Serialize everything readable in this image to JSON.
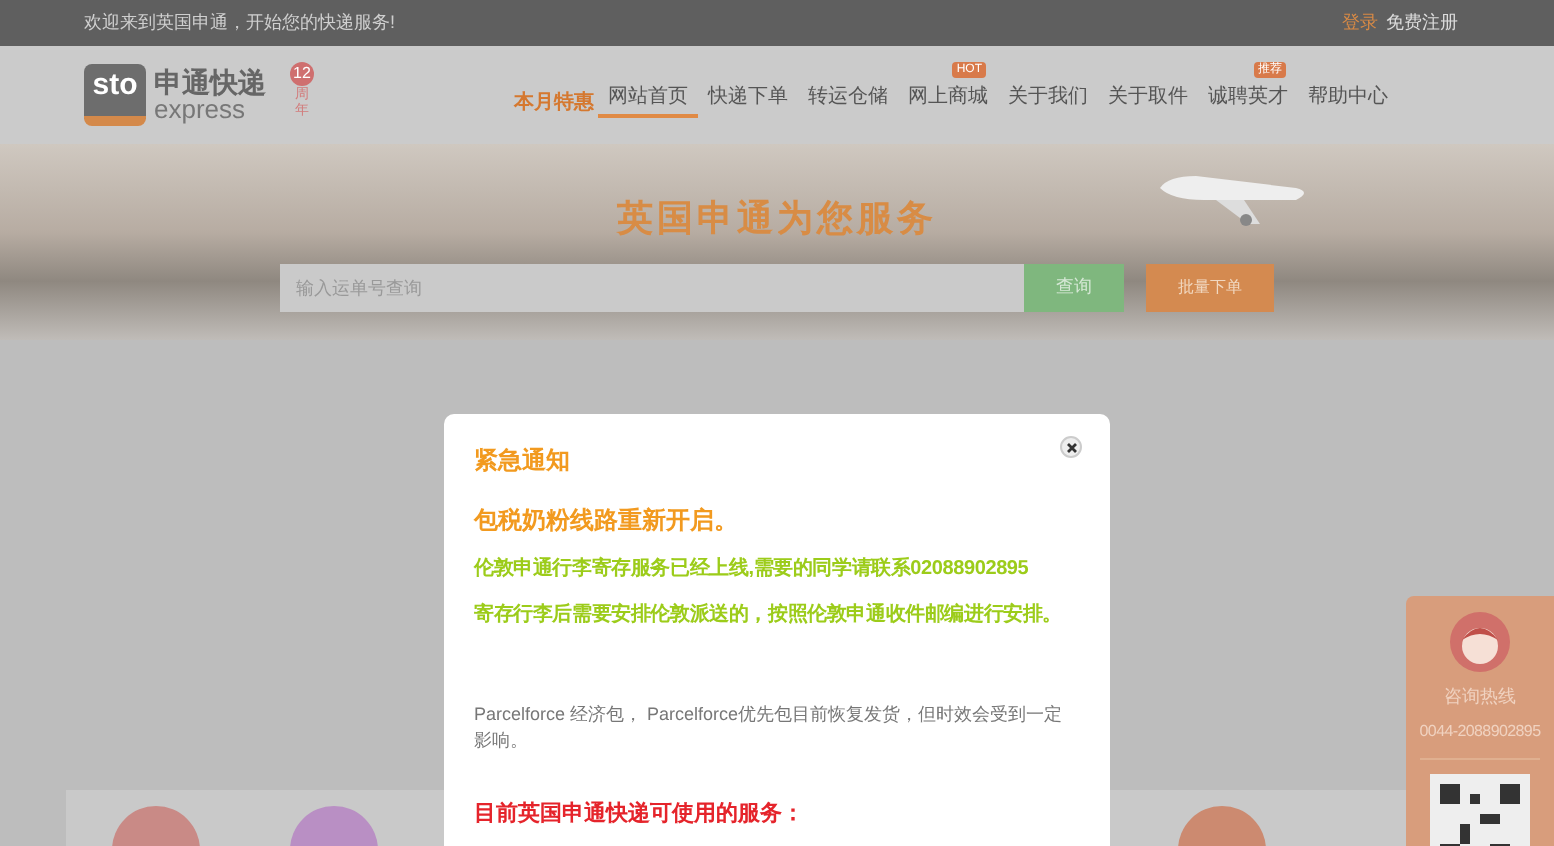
{
  "top_bar": {
    "welcome": "欢迎来到英国申通，开始您的快递服务!",
    "login": "登录",
    "register": "免费注册"
  },
  "header": {
    "logo": {
      "mark": "sto",
      "name": "申通快递",
      "name_en": "express"
    },
    "anniversary": {
      "number": "12",
      "chars": [
        "周",
        "年"
      ]
    },
    "promo": "本月特惠"
  },
  "nav": [
    {
      "label": "网站首页",
      "selected": true
    },
    {
      "label": "快递下单",
      "selected": false
    },
    {
      "label": "转运仓储",
      "selected": false
    },
    {
      "label": "网上商城",
      "selected": false,
      "badge": "HOT"
    },
    {
      "label": "关于我们",
      "selected": false
    },
    {
      "label": "关于取件",
      "selected": false
    },
    {
      "label": "诚聘英才",
      "selected": false,
      "badge": "推荐"
    },
    {
      "label": "帮助中心",
      "selected": false
    }
  ],
  "banner": {
    "title": "英国申通为您服务",
    "search": {
      "placeholder": "输入运单号查询"
    },
    "query_button": "查询",
    "batch_button": "批量下单"
  },
  "modal": {
    "title": "紧急通知",
    "lines": [
      {
        "kind": "headline",
        "text": "包税奶粉线路重新开启。"
      },
      {
        "kind": "highlight",
        "text": "伦敦申通行李寄存服务已经上线,需要的同学请联系02088902895"
      },
      {
        "kind": "highlight",
        "text": "寄存行李后需要安排伦敦派送的，按照伦敦申通收件邮编进行安排。"
      },
      {
        "kind": "body",
        "text": "Parcelforce 经济包， Parcelforce优先包目前恢复发货，但时效会受到一定影响。"
      },
      {
        "kind": "notice",
        "text": "目前英国申通快递可使用的服务："
      }
    ]
  },
  "hotline": {
    "label": "咨询热线",
    "phone": "0044-2088902895"
  },
  "services": [
    {
      "color": "#c98a86"
    },
    {
      "color": "#b98fc4"
    },
    {
      "color": "#cc8a70"
    }
  ]
}
